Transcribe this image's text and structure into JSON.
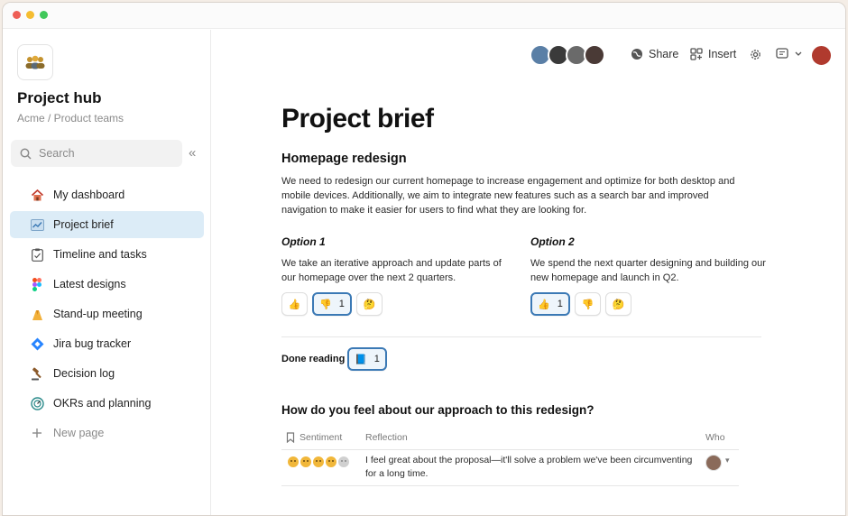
{
  "window": {
    "colors": {
      "close": "#ee5f57",
      "minimize": "#f5bd31",
      "zoom": "#41c85b"
    }
  },
  "sidebar": {
    "logo_icon": "team-icon",
    "title": "Project hub",
    "subtitle": "Acme / Product teams",
    "search_placeholder": "Search",
    "collapse_icon": "«",
    "items": [
      {
        "label": "My dashboard",
        "icon": "house-icon"
      },
      {
        "label": "Project brief",
        "icon": "chart-icon",
        "active": true
      },
      {
        "label": "Timeline and tasks",
        "icon": "clipboard-icon"
      },
      {
        "label": "Latest designs",
        "icon": "figma-icon"
      },
      {
        "label": "Stand-up meeting",
        "icon": "hands-icon"
      },
      {
        "label": "Jira bug tracker",
        "icon": "jira-icon"
      },
      {
        "label": "Decision log",
        "icon": "gavel-icon"
      },
      {
        "label": "OKRs and planning",
        "icon": "target-icon"
      },
      {
        "label": "New page",
        "icon": "plus-icon"
      }
    ],
    "accent": "#dcecf7"
  },
  "topbar": {
    "share_label": "Share",
    "insert_label": "Insert",
    "settings_icon": "gear-icon",
    "comment_icon": "comment-icon"
  },
  "doc": {
    "title": "Project brief",
    "section_title": "Homepage redesign",
    "intro": "We need to redesign our current homepage to increase engagement and optimize for both desktop and mobile devices. Additionally, we aim to integrate new features such as a search bar and improved navigation to make it easier for users to find what they are looking for.",
    "option1": {
      "title": "Option 1",
      "text": "We take an iterative approach and update parts of our homepage over the next 2 quarters.",
      "reactions": [
        {
          "emoji": "👍",
          "count": ""
        },
        {
          "emoji": "👎",
          "count": "1",
          "selected": true
        },
        {
          "emoji": "🤔",
          "count": ""
        }
      ]
    },
    "option2": {
      "title": "Option 2",
      "text": "We spend the next quarter designing and building our new homepage and launch in Q2.",
      "reactions": [
        {
          "emoji": "👍",
          "count": "1",
          "selected": true
        },
        {
          "emoji": "👎",
          "count": ""
        },
        {
          "emoji": "🤔",
          "count": ""
        }
      ]
    },
    "done_reading": {
      "label": "Done reading",
      "emoji": "📘",
      "count": "1"
    },
    "question": "How do you feel about our approach to this redesign?",
    "table": {
      "headers": {
        "sentiment": "Sentiment",
        "reflection": "Reflection",
        "who": "Who"
      },
      "rows": [
        {
          "sentiment_faces": 5,
          "reflection": "I feel great about the proposal—it'll solve a problem we've been circumventing for a long time."
        }
      ]
    },
    "selected_color": "#3b79b5"
  }
}
